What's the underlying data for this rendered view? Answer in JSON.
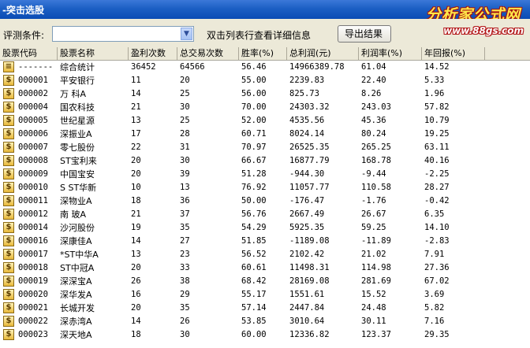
{
  "window": {
    "title": "-突击选股"
  },
  "watermark": {
    "brand": "分析家公式网",
    "url": "www.88gs.com"
  },
  "toolbar": {
    "criteria_label": "评测条件:",
    "criteria_value": "",
    "hint": "双击列表行查看详细信息",
    "export_button": "导出结果"
  },
  "table": {
    "columns": [
      "股票代码",
      "股票名称",
      "盈利次数",
      "总交易次数",
      "胜率(%)",
      "总利润(元)",
      "利润率(%)",
      "年回报(%)"
    ],
    "rows": [
      {
        "code": "-------",
        "name": "综合统计",
        "wins": "36452",
        "trades": "64566",
        "winrate": "56.46",
        "profit": "14966389.78",
        "profit_rate": "61.04",
        "annual": "14.52"
      },
      {
        "code": "000001",
        "name": "平安银行",
        "wins": "11",
        "trades": "20",
        "winrate": "55.00",
        "profit": "2239.83",
        "profit_rate": "22.40",
        "annual": "5.33"
      },
      {
        "code": "000002",
        "name": "万  科A",
        "wins": "14",
        "trades": "25",
        "winrate": "56.00",
        "profit": "825.73",
        "profit_rate": "8.26",
        "annual": "1.96"
      },
      {
        "code": "000004",
        "name": "国农科技",
        "wins": "21",
        "trades": "30",
        "winrate": "70.00",
        "profit": "24303.32",
        "profit_rate": "243.03",
        "annual": "57.82"
      },
      {
        "code": "000005",
        "name": "世纪星源",
        "wins": "13",
        "trades": "25",
        "winrate": "52.00",
        "profit": "4535.56",
        "profit_rate": "45.36",
        "annual": "10.79"
      },
      {
        "code": "000006",
        "name": "深振业A",
        "wins": "17",
        "trades": "28",
        "winrate": "60.71",
        "profit": "8024.14",
        "profit_rate": "80.24",
        "annual": "19.25"
      },
      {
        "code": "000007",
        "name": "零七股份",
        "wins": "22",
        "trades": "31",
        "winrate": "70.97",
        "profit": "26525.35",
        "profit_rate": "265.25",
        "annual": "63.11"
      },
      {
        "code": "000008",
        "name": "ST宝利来",
        "wins": "20",
        "trades": "30",
        "winrate": "66.67",
        "profit": "16877.79",
        "profit_rate": "168.78",
        "annual": "40.16"
      },
      {
        "code": "000009",
        "name": "中国宝安",
        "wins": "20",
        "trades": "39",
        "winrate": "51.28",
        "profit": "-944.30",
        "profit_rate": "-9.44",
        "annual": "-2.25"
      },
      {
        "code": "000010",
        "name": "S ST华新",
        "wins": "10",
        "trades": "13",
        "winrate": "76.92",
        "profit": "11057.77",
        "profit_rate": "110.58",
        "annual": "28.27"
      },
      {
        "code": "000011",
        "name": "深物业A",
        "wins": "18",
        "trades": "36",
        "winrate": "50.00",
        "profit": "-176.47",
        "profit_rate": "-1.76",
        "annual": "-0.42"
      },
      {
        "code": "000012",
        "name": "南  玻A",
        "wins": "21",
        "trades": "37",
        "winrate": "56.76",
        "profit": "2667.49",
        "profit_rate": "26.67",
        "annual": "6.35"
      },
      {
        "code": "000014",
        "name": "沙河股份",
        "wins": "19",
        "trades": "35",
        "winrate": "54.29",
        "profit": "5925.35",
        "profit_rate": "59.25",
        "annual": "14.10"
      },
      {
        "code": "000016",
        "name": "深康佳A",
        "wins": "14",
        "trades": "27",
        "winrate": "51.85",
        "profit": "-1189.08",
        "profit_rate": "-11.89",
        "annual": "-2.83"
      },
      {
        "code": "000017",
        "name": "*ST中华A",
        "wins": "13",
        "trades": "23",
        "winrate": "56.52",
        "profit": "2102.42",
        "profit_rate": "21.02",
        "annual": "7.91"
      },
      {
        "code": "000018",
        "name": "ST中冠A",
        "wins": "20",
        "trades": "33",
        "winrate": "60.61",
        "profit": "11498.31",
        "profit_rate": "114.98",
        "annual": "27.36"
      },
      {
        "code": "000019",
        "name": "深深宝A",
        "wins": "26",
        "trades": "38",
        "winrate": "68.42",
        "profit": "28169.08",
        "profit_rate": "281.69",
        "annual": "67.02"
      },
      {
        "code": "000020",
        "name": "深华发A",
        "wins": "16",
        "trades": "29",
        "winrate": "55.17",
        "profit": "1551.61",
        "profit_rate": "15.52",
        "annual": "3.69"
      },
      {
        "code": "000021",
        "name": "长城开发",
        "wins": "20",
        "trades": "35",
        "winrate": "57.14",
        "profit": "2447.84",
        "profit_rate": "24.48",
        "annual": "5.82"
      },
      {
        "code": "000022",
        "name": "深赤湾A",
        "wins": "14",
        "trades": "26",
        "winrate": "53.85",
        "profit": "3010.64",
        "profit_rate": "30.11",
        "annual": "7.16"
      },
      {
        "code": "000023",
        "name": "深天地A",
        "wins": "18",
        "trades": "30",
        "winrate": "60.00",
        "profit": "12336.82",
        "profit_rate": "123.37",
        "annual": "29.35"
      }
    ]
  }
}
